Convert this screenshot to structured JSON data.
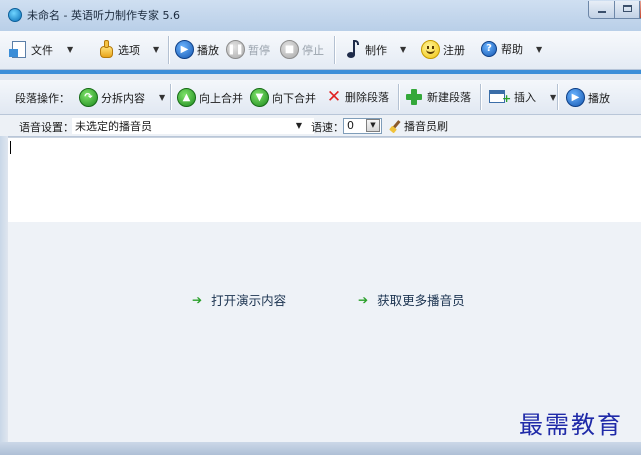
{
  "window": {
    "title": "未命名 - 英语听力制作专家 5.6"
  },
  "toolbar_main": {
    "file": "文件",
    "options": "选项",
    "play": "播放",
    "pause": "暂停",
    "stop": "停止",
    "make": "制作",
    "register": "注册",
    "help": "帮助"
  },
  "toolbar_paragraph": {
    "label": "段落操作：",
    "split": "分拆内容",
    "merge_up": "向上合并",
    "merge_down": "向下合并",
    "delete": "删除段落",
    "new": "新建段落",
    "insert": "插入",
    "play": "播放"
  },
  "voice": {
    "label": "语音设置：",
    "speaker_value": "未选定的播音员",
    "speed_label": "语速：",
    "speed_value": "0",
    "refresh": "播音员刷"
  },
  "links": {
    "open_demo": "打开演示内容",
    "get_more": "获取更多播音员"
  },
  "watermark": "最需教育",
  "colors": {
    "accent": "#3b8ed8",
    "link_arrow": "#2aa02a"
  }
}
